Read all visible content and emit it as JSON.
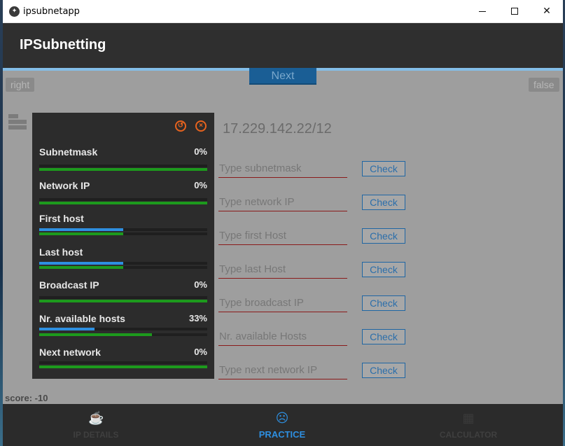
{
  "window": {
    "title": "ipsubnetapp"
  },
  "app": {
    "title": "IPSubnetting"
  },
  "top_controls": {
    "right_label": "right",
    "next_label": "Next",
    "false_label": "false"
  },
  "question": {
    "ip": "17.229.142.22/12"
  },
  "fields": [
    {
      "placeholder": "Type subnetmask",
      "check": "Check"
    },
    {
      "placeholder": "Type network IP",
      "check": "Check"
    },
    {
      "placeholder": "Type first Host",
      "check": "Check"
    },
    {
      "placeholder": "Type last Host",
      "check": "Check"
    },
    {
      "placeholder": "Type broadcast IP",
      "check": "Check"
    },
    {
      "placeholder": "Nr. available Hosts",
      "check": "Check"
    },
    {
      "placeholder": "Type next network IP",
      "check": "Check"
    }
  ],
  "score": "score: -10",
  "stats": {
    "reset_icon": "history-icon",
    "close_icon": "close-circle-icon",
    "items": [
      {
        "label": "Subnetmask",
        "percent": "0%",
        "blue_fraction": 0,
        "green_fraction": 1.0
      },
      {
        "label": "Network IP",
        "percent": "0%",
        "blue_fraction": 0,
        "green_fraction": 1.0
      },
      {
        "label": "First host",
        "percent": "",
        "blue_fraction": 0.5,
        "green_fraction": 0.5
      },
      {
        "label": "Last host",
        "percent": "",
        "blue_fraction": 0.5,
        "green_fraction": 0.5
      },
      {
        "label": "Broadcast IP",
        "percent": "0%",
        "blue_fraction": 0,
        "green_fraction": 1.0
      },
      {
        "label": "Nr. available hosts",
        "percent": "33%",
        "blue_fraction": 0.33,
        "green_fraction": 0.67
      },
      {
        "label": "Next network",
        "percent": "0%",
        "blue_fraction": 0,
        "green_fraction": 1.0
      }
    ]
  },
  "nav": [
    {
      "label": "IP DETAILS",
      "icon": "coffee-icon",
      "active": false
    },
    {
      "label": "PRACTICE",
      "icon": "sad-face-icon",
      "active": true
    },
    {
      "label": "CALCULATOR",
      "icon": "calculator-icon",
      "active": false
    }
  ],
  "colors": {
    "accent": "#2e8fe0",
    "progress_green": "#1d9a1d",
    "icon_orange": "#e7631e",
    "appbar": "#2f2f2f"
  }
}
